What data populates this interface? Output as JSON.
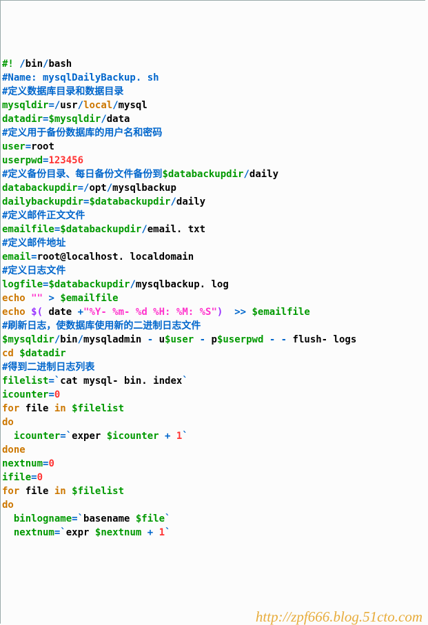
{
  "lines": [
    [
      [
        "gr",
        "#! "
      ],
      [
        "bl",
        "/"
      ],
      [
        "blk",
        "bin"
      ],
      [
        "bl",
        "/"
      ],
      [
        "blk",
        "bash"
      ]
    ],
    [
      [
        "bl",
        "#Name: mysqlDailyBackup. sh"
      ]
    ],
    [
      [
        "bl",
        "#定义数据库目录和数据目录"
      ]
    ],
    [
      [
        "gr",
        "mysqldir"
      ],
      [
        "bl",
        "=/"
      ],
      [
        "blk",
        "usr"
      ],
      [
        "bl",
        "/"
      ],
      [
        "or",
        "local"
      ],
      [
        "bl",
        "/"
      ],
      [
        "blk",
        "mysql"
      ]
    ],
    [
      [
        "gr",
        "datadir"
      ],
      [
        "bl",
        "="
      ],
      [
        "gr",
        "$mysqldir"
      ],
      [
        "bl",
        "/"
      ],
      [
        "blk",
        "data"
      ]
    ],
    [
      [
        "bl",
        "#定义用于备份数据库的用户名和密码"
      ]
    ],
    [
      [
        "gr",
        "user"
      ],
      [
        "bl",
        "="
      ],
      [
        "blk",
        "root"
      ]
    ],
    [
      [
        "gr",
        "userpwd"
      ],
      [
        "bl",
        "="
      ],
      [
        "rd",
        "123456"
      ]
    ],
    [
      [
        "bl",
        "#定义备份目录、每日备份文件备份到"
      ],
      [
        "gr",
        "$databackupdir"
      ],
      [
        "bl",
        "/"
      ],
      [
        "blk",
        "daily"
      ]
    ],
    [
      [
        "gr",
        "databackupdir"
      ],
      [
        "bl",
        "=/"
      ],
      [
        "blk",
        "opt"
      ],
      [
        "bl",
        "/"
      ],
      [
        "blk",
        "mysqlbackup"
      ]
    ],
    [
      [
        "gr",
        "dailybackupdir"
      ],
      [
        "bl",
        "="
      ],
      [
        "gr",
        "$databackupdir"
      ],
      [
        "bl",
        "/"
      ],
      [
        "blk",
        "daily"
      ]
    ],
    [
      [
        "bl",
        "#定义邮件正文文件"
      ]
    ],
    [
      [
        "gr",
        "emailfile"
      ],
      [
        "bl",
        "="
      ],
      [
        "gr",
        "$databackupdir"
      ],
      [
        "bl",
        "/"
      ],
      [
        "blk",
        "email. txt"
      ]
    ],
    [
      [
        "bl",
        "#定义邮件地址"
      ]
    ],
    [
      [
        "gr",
        "email"
      ],
      [
        "bl",
        "="
      ],
      [
        "blk",
        "root@localhost. localdomain"
      ]
    ],
    [
      [
        "bl",
        "#定义日志文件"
      ]
    ],
    [
      [
        "gr",
        "logfile"
      ],
      [
        "bl",
        "="
      ],
      [
        "gr",
        "$databackupdir"
      ],
      [
        "bl",
        "/"
      ],
      [
        "blk",
        "mysqlbackup. log"
      ]
    ],
    [
      [
        "or",
        "echo"
      ],
      [
        "blk",
        " "
      ],
      [
        "mg",
        "\"\""
      ],
      [
        "blk",
        " "
      ],
      [
        "bl",
        "> "
      ],
      [
        "gr",
        "$emailfile"
      ]
    ],
    [
      [
        "or",
        "echo"
      ],
      [
        "blk",
        " "
      ],
      [
        "pu",
        "$("
      ],
      [
        "blk",
        " date "
      ],
      [
        "bl",
        "+"
      ],
      [
        "mg",
        "\"%Y- %m- %d %H: %M: %S\""
      ],
      [
        "pu",
        ")"
      ],
      [
        "blk",
        "  "
      ],
      [
        "bl",
        ">> "
      ],
      [
        "gr",
        "$emailfile"
      ]
    ],
    [
      [
        "bl",
        "#刷新日志，使数据库使用新的二进制日志文件"
      ]
    ],
    [
      [
        "gr",
        "$mysqldir"
      ],
      [
        "bl",
        "/"
      ],
      [
        "blk",
        "bin"
      ],
      [
        "bl",
        "/"
      ],
      [
        "blk",
        "mysqladmin "
      ],
      [
        "bl",
        "-"
      ],
      [
        "blk",
        " u"
      ],
      [
        "gr",
        "$user"
      ],
      [
        "blk",
        " "
      ],
      [
        "bl",
        "-"
      ],
      [
        "blk",
        " p"
      ],
      [
        "gr",
        "$userpwd"
      ],
      [
        "blk",
        " "
      ],
      [
        "bl",
        "- -"
      ],
      [
        "blk",
        " flush- logs"
      ]
    ],
    [
      [
        "or",
        "cd"
      ],
      [
        "blk",
        " "
      ],
      [
        "gr",
        "$datadir"
      ]
    ],
    [
      [
        "bl",
        "#得到二进制日志列表"
      ]
    ],
    [
      [
        "gr",
        "filelist"
      ],
      [
        "bl",
        "=`"
      ],
      [
        "blk",
        "cat mysql- bin. index"
      ],
      [
        "bl",
        "`"
      ]
    ],
    [
      [
        "gr",
        "icounter"
      ],
      [
        "bl",
        "="
      ],
      [
        "rd",
        "0"
      ]
    ],
    [
      [
        "or",
        "for"
      ],
      [
        "blk",
        " file "
      ],
      [
        "or",
        "in"
      ],
      [
        "blk",
        " "
      ],
      [
        "gr",
        "$filelist"
      ]
    ],
    [
      [
        "or",
        "do"
      ]
    ],
    [
      [
        "blk",
        "  "
      ],
      [
        "gr",
        "icounter"
      ],
      [
        "bl",
        "=`"
      ],
      [
        "blk",
        "exper "
      ],
      [
        "gr",
        "$icounter"
      ],
      [
        "blk",
        " "
      ],
      [
        "bl",
        "+"
      ],
      [
        "blk",
        " "
      ],
      [
        "rd",
        "1"
      ],
      [
        "bl",
        "`"
      ]
    ],
    [
      [
        "or",
        "done"
      ]
    ],
    [
      [
        "gr",
        "nextnum"
      ],
      [
        "bl",
        "="
      ],
      [
        "rd",
        "0"
      ]
    ],
    [
      [
        "gr",
        "ifile"
      ],
      [
        "bl",
        "="
      ],
      [
        "rd",
        "0"
      ]
    ],
    [
      [
        "or",
        "for"
      ],
      [
        "blk",
        " file "
      ],
      [
        "or",
        "in"
      ],
      [
        "blk",
        " "
      ],
      [
        "gr",
        "$filelist"
      ]
    ],
    [
      [
        "or",
        "do"
      ]
    ],
    [
      [
        "blk",
        "  "
      ],
      [
        "gr",
        "binlogname"
      ],
      [
        "bl",
        "=`"
      ],
      [
        "blk",
        "basename "
      ],
      [
        "gr",
        "$file"
      ],
      [
        "bl",
        "`"
      ]
    ],
    [
      [
        "blk",
        "  "
      ],
      [
        "gr",
        "nextnum"
      ],
      [
        "bl",
        "=`"
      ],
      [
        "blk",
        "expr "
      ],
      [
        "gr",
        "$nextnum"
      ],
      [
        "blk",
        " "
      ],
      [
        "bl",
        "+"
      ],
      [
        "blk",
        " "
      ],
      [
        "rd",
        "1"
      ],
      [
        "bl",
        "`"
      ]
    ]
  ],
  "watermark": "http://zpf666.blog.51cto.com"
}
